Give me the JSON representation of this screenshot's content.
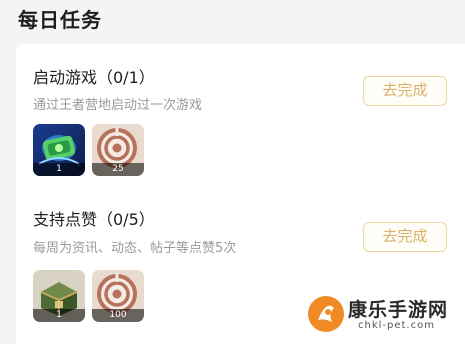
{
  "page": {
    "title": "每日任务"
  },
  "tasks": [
    {
      "title": "启动游戏（0/1）",
      "description": "通过王者营地启动过一次游戏",
      "button_label": "去完成",
      "rewards": [
        {
          "icon": "card-icon",
          "count": "1"
        },
        {
          "icon": "target-icon",
          "count": "25"
        }
      ]
    },
    {
      "title": "支持点赞（0/5）",
      "description": "每周为资讯、动态、帖子等点赞5次",
      "button_label": "去完成",
      "rewards": [
        {
          "icon": "chest-icon",
          "count": "1"
        },
        {
          "icon": "target-icon",
          "count": "100"
        }
      ]
    }
  ],
  "watermark": {
    "name": "康乐手游网",
    "url": "chkl-pet.com"
  },
  "colors": {
    "background": "#f4f4f6",
    "button_border": "#ecd6a2",
    "button_text": "#d9b26a",
    "subtext": "#9a9a9a"
  }
}
